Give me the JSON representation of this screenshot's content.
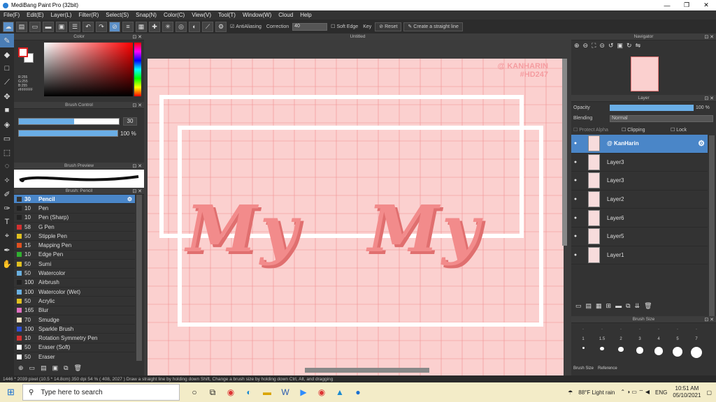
{
  "window": {
    "title": "MediBang Paint Pro (32bit)",
    "minimize": "—",
    "maximize": "❐",
    "close": "✕"
  },
  "menu": [
    "File(F)",
    "Edit(E)",
    "Layer(L)",
    "Filter(R)",
    "Select(S)",
    "Snap(N)",
    "Color(C)",
    "View(V)",
    "Tool(T)",
    "Window(W)",
    "Cloud",
    "Help"
  ],
  "toolbar": {
    "antialiasing": "AntiAliasing",
    "correction_label": "Correction",
    "correction_value": "40",
    "soft_edge": "Soft Edge",
    "key": "Key",
    "reset": "Reset",
    "straight_line": "Create a straight line"
  },
  "color_panel": {
    "title": "Color",
    "r": "R:255",
    "g": "G:255",
    "b": "B:255",
    "hex": "#FFFFFF",
    "primary_color": "#FFFFFF",
    "secondary_color": "#FFFFFF"
  },
  "brush_control": {
    "title": "Brush Control",
    "size": "30",
    "opacity": "100 %",
    "size_fraction": 0.55,
    "opacity_fraction": 1.0
  },
  "brush_preview": {
    "title": "Brush Preview"
  },
  "brush_list": {
    "title": "Brush: Pencil",
    "items": [
      {
        "size": "30",
        "name": "Pencil",
        "color": "#333333",
        "selected": true
      },
      {
        "size": "10",
        "name": "Pen",
        "color": "#222222"
      },
      {
        "size": "10",
        "name": "Pen (Sharp)",
        "color": "#222222"
      },
      {
        "size": "58",
        "name": "G Pen",
        "color": "#d43030"
      },
      {
        "size": "50",
        "name": "Stipple Pen",
        "color": "#e0c020"
      },
      {
        "size": "15",
        "name": "Mapping Pen",
        "color": "#e05020"
      },
      {
        "size": "10",
        "name": "Edge Pen",
        "color": "#30b030"
      },
      {
        "size": "50",
        "name": "Sumi",
        "color": "#e0c020"
      },
      {
        "size": "50",
        "name": "Watercolor",
        "color": "#6ab0e0"
      },
      {
        "size": "100",
        "name": "Airbrush",
        "color": "#222222"
      },
      {
        "size": "100",
        "name": "Watercolor (Wet)",
        "color": "#6ab0e0"
      },
      {
        "size": "50",
        "name": "Acrylic",
        "color": "#e0c020"
      },
      {
        "size": "165",
        "name": "Blur",
        "color": "#e070c0"
      },
      {
        "size": "70",
        "name": "Smudge",
        "color": "#f0e0c0"
      },
      {
        "size": "100",
        "name": "Sparkle Brush",
        "color": "#3050d0"
      },
      {
        "size": "10",
        "name": "Rotation Symmetry Pen",
        "color": "#d43030"
      },
      {
        "size": "50",
        "name": "Eraser (Soft)",
        "color": "#ffffff"
      },
      {
        "size": "50",
        "name": "Eraser",
        "color": "#ffffff"
      }
    ]
  },
  "canvas": {
    "tab": "Untitled",
    "text_left": "My",
    "text_right": "My",
    "watermark_1": "@ KANHARIN",
    "watermark_2": "#HD247",
    "bg_color": "#fbd0cf",
    "text_color": "#f28b8b"
  },
  "navigator": {
    "title": "Navigator"
  },
  "layer_panel": {
    "title": "Layer",
    "opacity_label": "Opacity",
    "opacity_value": "100 %",
    "blending_label": "Blending",
    "blending_value": "Normal",
    "protect_alpha": "Protect Alpha",
    "clipping": "Clipping",
    "lock": "Lock",
    "layers": [
      {
        "name": "@ KanHarin",
        "selected": true
      },
      {
        "name": "Layer3"
      },
      {
        "name": "Layer3"
      },
      {
        "name": "Layer2"
      },
      {
        "name": "Layer6"
      },
      {
        "name": "Layer5"
      },
      {
        "name": "Layer1"
      }
    ]
  },
  "brush_size": {
    "title": "Brush Size",
    "labels": [
      "1",
      "1.5",
      "2",
      "3",
      "4",
      "5",
      "7"
    ],
    "tabs": [
      "Brush Size",
      "Reference"
    ]
  },
  "status": {
    "text": "1446 * 2039 pixel  (10.5 * 14.8cm)  350 dpi  54 %  ( 408, 2027 )  Draw a straight line by holding down Shift, Change a brush size by holding down Ctrl, Alt, and dragging"
  },
  "taskbar": {
    "search_placeholder": "Type here to search",
    "weather": "88°F Light rain",
    "lang": "ENG",
    "time": "10:51 AM",
    "date": "05/10/2021"
  }
}
